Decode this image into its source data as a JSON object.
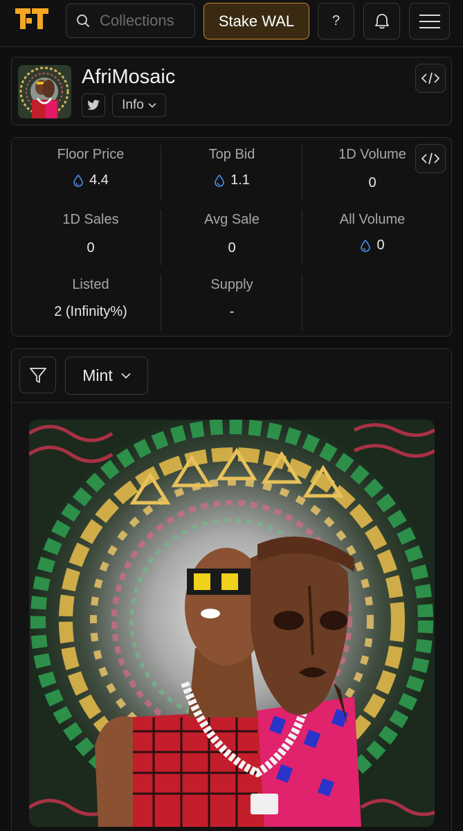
{
  "nav": {
    "search_placeholder": "Collections",
    "stake_label": "Stake WAL",
    "help_label": "?"
  },
  "collection": {
    "name": "AfriMosaic",
    "info_label": "Info"
  },
  "stats": [
    {
      "label": "Floor Price",
      "value": "4.4",
      "icon": "wal-drop-icon"
    },
    {
      "label": "Top Bid",
      "value": "1.1",
      "icon": "wal-drop-icon"
    },
    {
      "label": "1D Volume",
      "value": "0"
    },
    {
      "label": "1D Sales",
      "value": "0"
    },
    {
      "label": "Avg Sale",
      "value": "0"
    },
    {
      "label": "All Volume",
      "value": "0",
      "icon": "wal-drop-icon"
    },
    {
      "label": "Listed",
      "value": "2 (Infinity%)"
    },
    {
      "label": "Supply",
      "value": "-"
    }
  ],
  "items": {
    "sort_label": "Mint"
  },
  "colors": {
    "accent": "#f5a623",
    "stake_border": "#c8892f",
    "drop_icon": "#4a8ff0"
  }
}
